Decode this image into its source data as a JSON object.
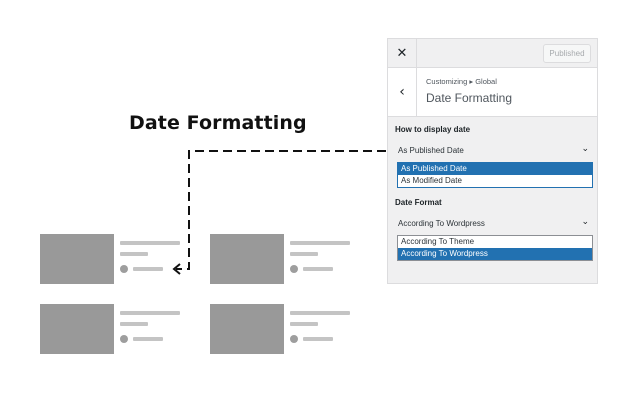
{
  "heading": "Date Formatting",
  "panel": {
    "close_icon": "close-icon",
    "published_label": "Published",
    "back_icon": "chevron-left-icon",
    "breadcrumb": "Customizing ▸ Global",
    "section_title": "Date Formatting",
    "display_date": {
      "label": "How to display date",
      "value": "As Published Date",
      "options": [
        "As Published Date",
        "As Modified Date"
      ],
      "selected_index": 0
    },
    "date_format": {
      "label": "Date Format",
      "value": "According To Wordpress",
      "options": [
        "According To Theme",
        "According To Wordpress"
      ],
      "selected_index": 1
    }
  },
  "colors": {
    "accent": "#2271b1",
    "thumb": "#999999",
    "line": "#c4c4c4"
  }
}
